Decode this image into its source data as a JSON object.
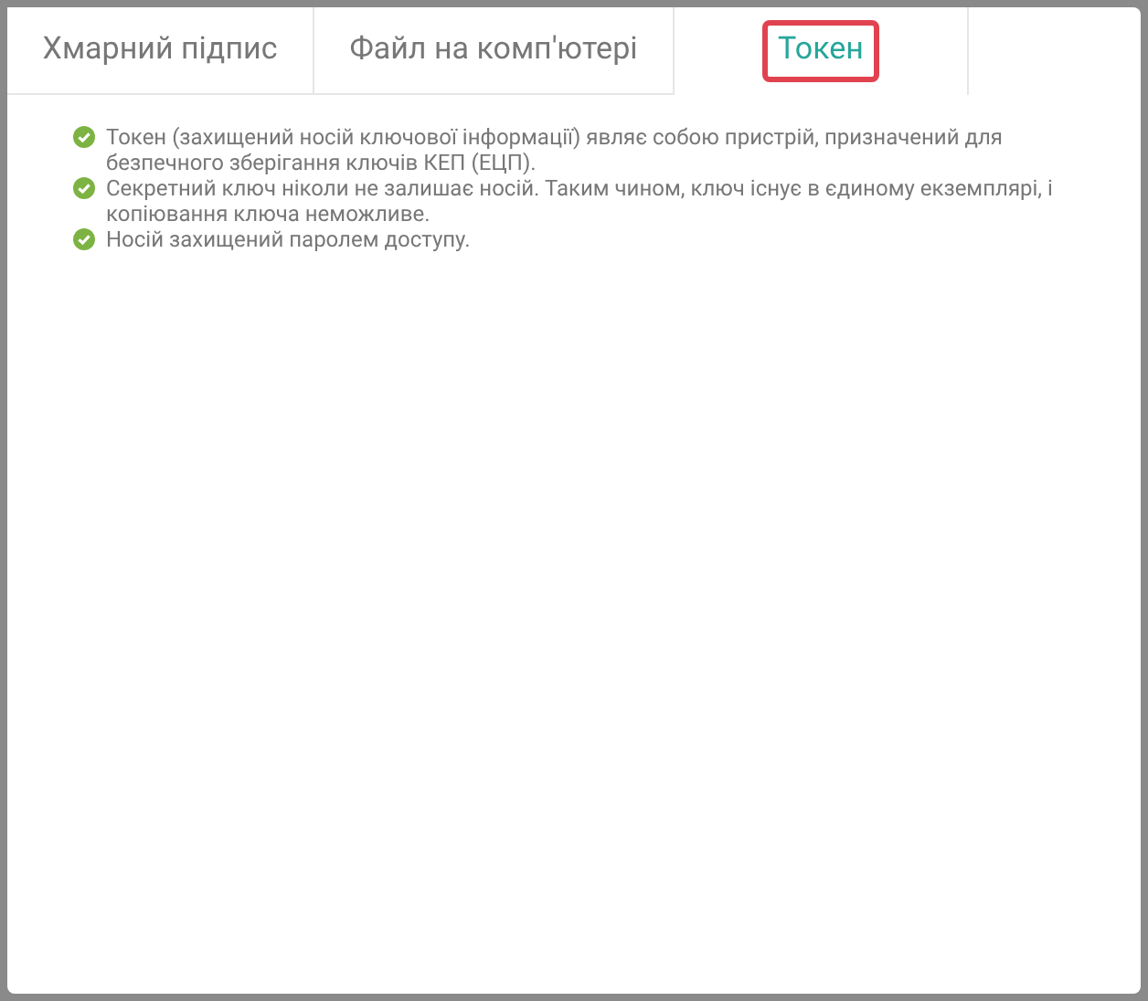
{
  "tabs": [
    {
      "label": "Хмарний підпис",
      "selected": false,
      "highlighted": false
    },
    {
      "label": "Файл на комп'ютері",
      "selected": false,
      "highlighted": false
    },
    {
      "label": "Токен",
      "selected": true,
      "highlighted": true
    }
  ],
  "features": [
    {
      "text": "Токен (захищений носій ключової інформації) являє собою пристрій, призначений для безпечного зберігання ключів КЕП (ЕЦП)."
    },
    {
      "text": "Секретний ключ ніколи не залишає носій. Таким чином, ключ існує в єдиному екземплярі, і копіювання ключа неможливе."
    },
    {
      "text": "Носій захищений паролем доступу."
    }
  ]
}
